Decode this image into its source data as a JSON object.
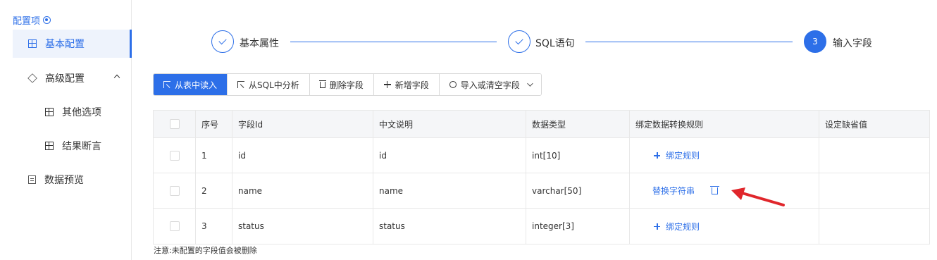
{
  "sidebar": {
    "title": "配置项",
    "items": [
      {
        "label": "基本配置",
        "icon": "grid-icon",
        "active": true
      },
      {
        "label": "高级配置",
        "icon": "cube-icon",
        "expanded": true
      },
      {
        "label": "其他选项",
        "icon": "grid-icon"
      },
      {
        "label": "结果断言",
        "icon": "grid-icon"
      },
      {
        "label": "数据预览",
        "icon": "document-search-icon"
      }
    ]
  },
  "steps": [
    {
      "label": "基本属性",
      "status": "done"
    },
    {
      "label": "SQL语句",
      "status": "done"
    },
    {
      "number": "3",
      "label": "输入字段",
      "status": "current"
    }
  ],
  "toolbar": {
    "read_from_table": "从表中读入",
    "parse_from_sql": "从SQL中分析",
    "delete_field": "删除字段",
    "add_field": "新增字段",
    "import_or_clear": "导入或清空字段"
  },
  "table": {
    "headers": [
      "序号",
      "字段Id",
      "中文说明",
      "数据类型",
      "绑定数据转换规则",
      "设定缺省值"
    ],
    "rows": [
      {
        "index": "1",
        "field_id": "id",
        "description": "id",
        "type": "int[10]",
        "rule": "绑定规则",
        "default": ""
      },
      {
        "index": "2",
        "field_id": "name",
        "description": "name",
        "type": "varchar[50]",
        "rule": "替换字符串",
        "default": ""
      },
      {
        "index": "3",
        "field_id": "status",
        "description": "status",
        "type": "integer[3]",
        "rule": "绑定规则",
        "default": ""
      }
    ]
  },
  "note": "注意:未配置的字段值会被删除",
  "colors": {
    "accent": "#2d6fe8",
    "arrow": "#e0262b"
  }
}
